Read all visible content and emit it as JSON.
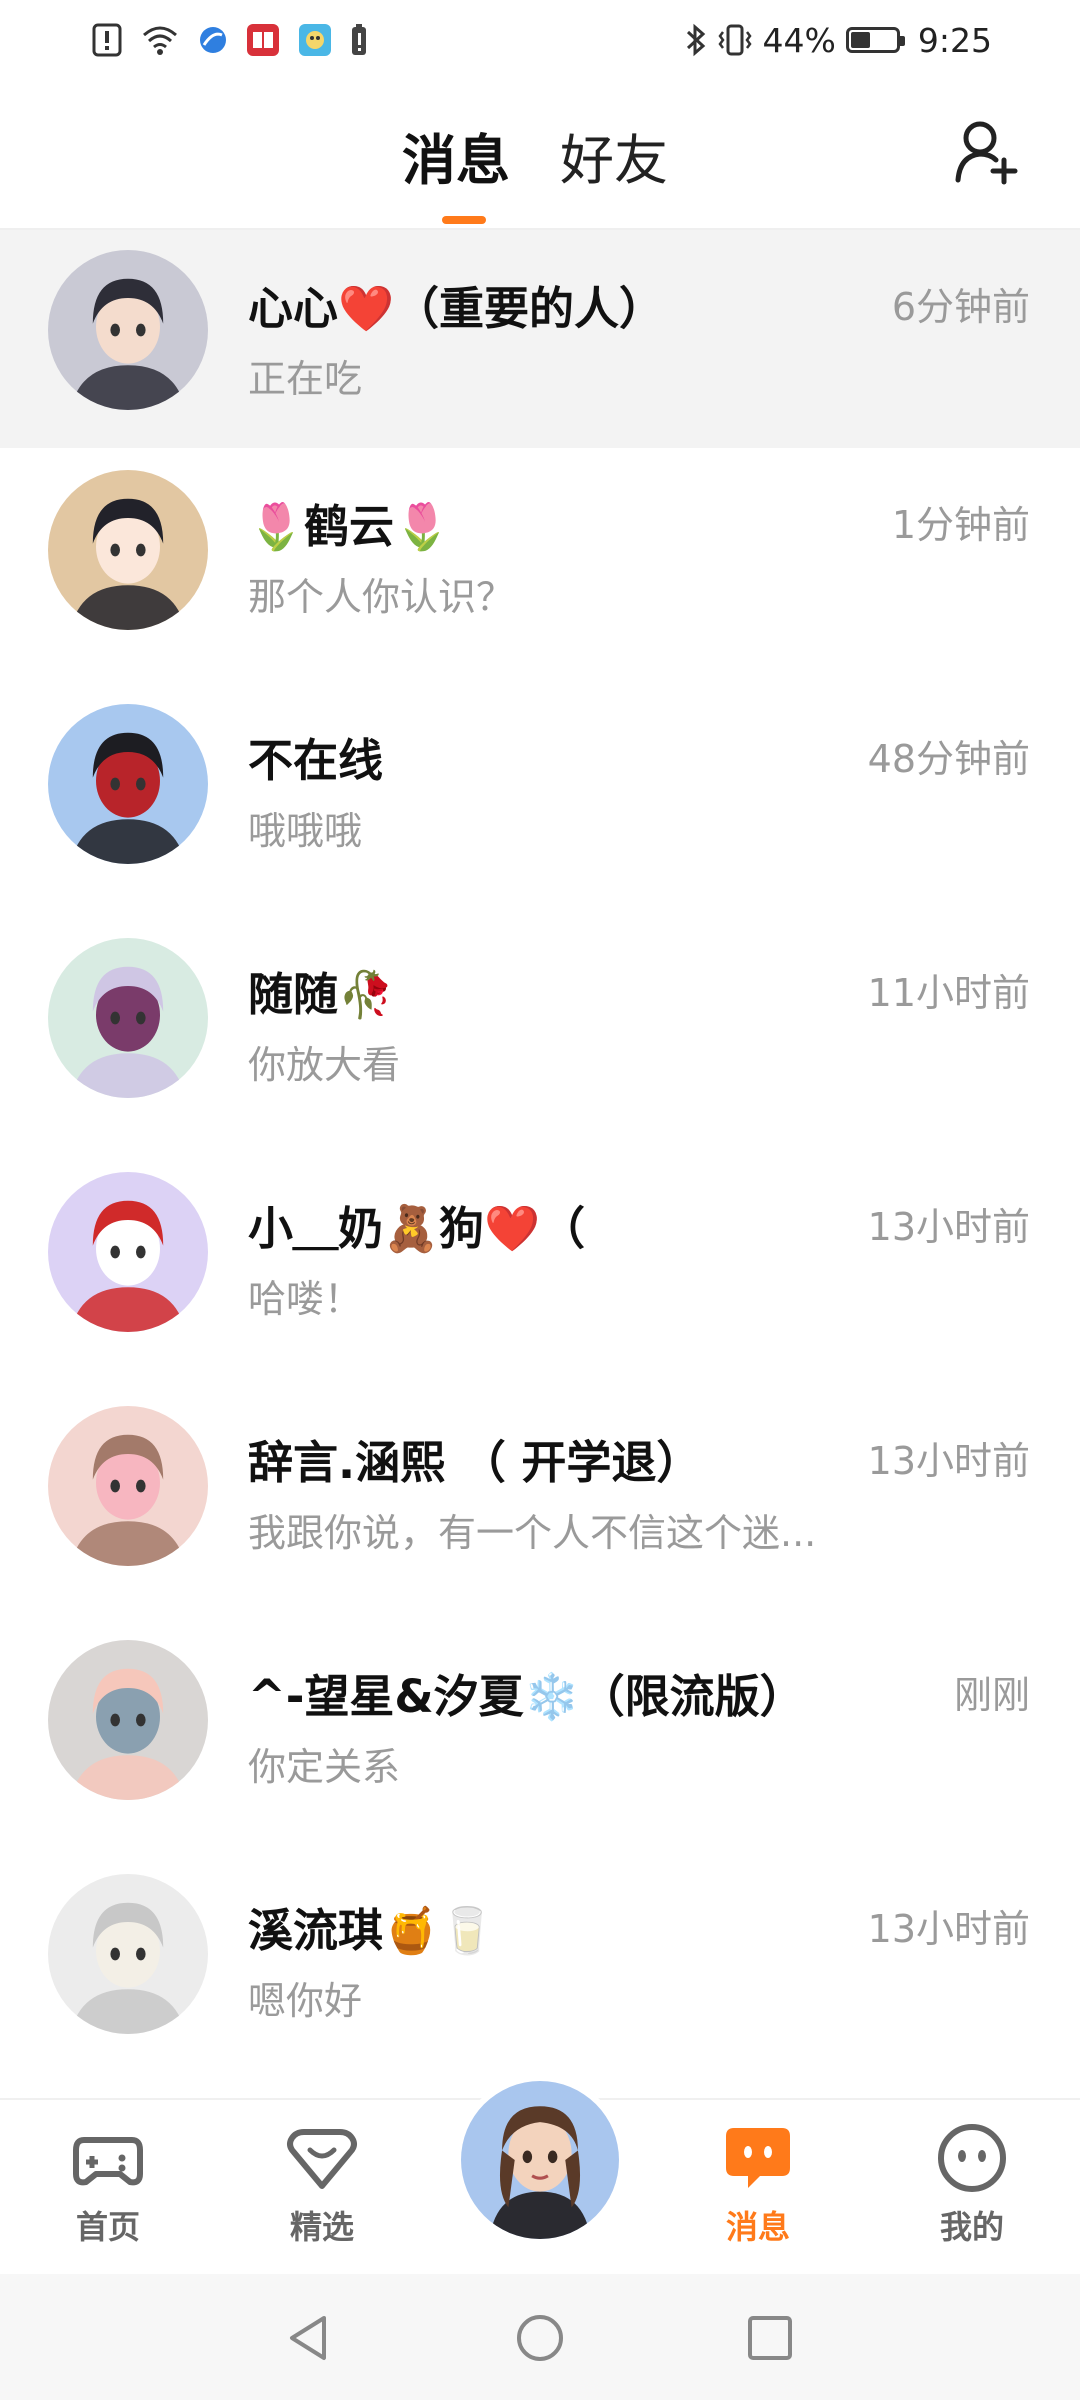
{
  "status_bar": {
    "battery_percent_text": "44%",
    "battery_level": 0.44,
    "time": "9:25",
    "icons_left": [
      "alert-icon",
      "wifi-icon",
      "browser-icon",
      "reader-icon",
      "game-icon",
      "warning-battery-icon"
    ],
    "icons_right": [
      "bluetooth-icon",
      "vibrate-icon",
      "battery-icon"
    ]
  },
  "header": {
    "tabs": [
      {
        "label": "消息",
        "active": true
      },
      {
        "label": "好友",
        "active": false
      }
    ],
    "accent_color": "#ff7a1a"
  },
  "conversations": [
    {
      "name": "心心❤️（重要的人）",
      "preview": "正在吃",
      "time": "6分钟前",
      "highlight": true,
      "avatar_colors": [
        "#c9c9d4",
        "#2e2e38",
        "#f4dccd"
      ]
    },
    {
      "name": "🌷鹤云🌷",
      "preview": "那个人你认识？",
      "time": "1分钟前",
      "highlight": false,
      "avatar_colors": [
        "#e2c7a2",
        "#22222a",
        "#fbe7da"
      ]
    },
    {
      "name": "不在线",
      "preview": "哦哦哦",
      "time": "48分钟前",
      "highlight": false,
      "avatar_colors": [
        "#a8c8ef",
        "#1d1d22",
        "#b8242a"
      ]
    },
    {
      "name": "随随🥀",
      "preview": "你放大看",
      "time": "11小时前",
      "highlight": false,
      "avatar_colors": [
        "#d8ebe2",
        "#cfc6e4",
        "#7a3b6a"
      ]
    },
    {
      "name": "小＿奶🧸狗❤️（",
      "preview": "哈喽！",
      "time": "13小时前",
      "highlight": false,
      "avatar_colors": [
        "#dcd2f5",
        "#d02a2a",
        "#ffffff"
      ]
    },
    {
      "name": "辞言.涵熙 （ 开学退）",
      "preview": "我跟你说，有一个人不信这个迷...",
      "time": "13小时前",
      "highlight": false,
      "avatar_colors": [
        "#f3d6d0",
        "#a37a6a",
        "#f7b6c0"
      ]
    },
    {
      "name": "^-望星&汐夏❄️（限流版）",
      "preview": "你定关系",
      "time": "刚刚",
      "highlight": false,
      "avatar_colors": [
        "#d9d6d4",
        "#f6c7bb",
        "#8aa0b0"
      ]
    },
    {
      "name": "溪流琪🍯🥛",
      "preview": "嗯你好",
      "time": "13小时前",
      "highlight": false,
      "avatar_colors": [
        "#ececec",
        "#c8c8c8",
        "#f3efe6"
      ]
    }
  ],
  "bottom_nav": {
    "items": [
      {
        "label": "首页",
        "icon": "gamepad-icon",
        "active": false
      },
      {
        "label": "精选",
        "icon": "heart-badge-icon",
        "active": false
      },
      {
        "label": "消息",
        "icon": "chat-bubble-icon",
        "active": true
      },
      {
        "label": "我的",
        "icon": "smiley-icon",
        "active": false
      }
    ],
    "center_icon": "profile-avatar",
    "inactive_color": "#666666",
    "active_color": "#ff7a1a"
  },
  "system_nav": {
    "icons": [
      "back-icon",
      "home-icon",
      "recents-icon"
    ]
  }
}
